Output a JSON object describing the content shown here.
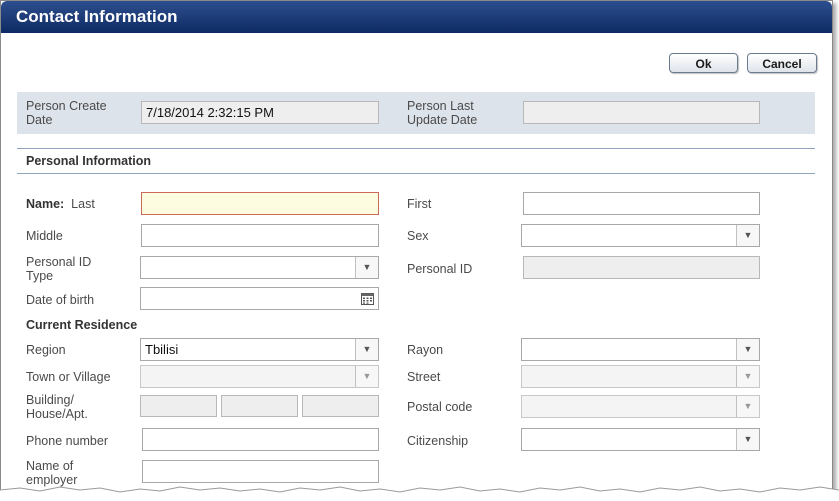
{
  "window": {
    "title": "Contact Information"
  },
  "toolbar": {
    "ok_label": "Ok",
    "cancel_label": "Cancel"
  },
  "info": {
    "create_label_1": "Person Create",
    "create_label_2": "Date",
    "create_value": "7/18/2014 2:32:15 PM",
    "update_label_1": "Person Last",
    "update_label_2": "Update Date",
    "update_value": ""
  },
  "personal": {
    "section_title": "Personal Information",
    "name_label": "Name:",
    "last_label": "Last",
    "last_value": "",
    "first_label": "First",
    "first_value": "",
    "middle_label": "Middle",
    "middle_value": "",
    "sex_label": "Sex",
    "sex_value": "",
    "pid_type_label_1": "Personal ID",
    "pid_type_label_2": "Type",
    "pid_type_value": "",
    "pid_label": "Personal ID",
    "pid_value": "",
    "dob_label": "Date of birth",
    "dob_value": ""
  },
  "residence": {
    "section_title": "Current Residence",
    "region_label": "Region",
    "region_value": "Tbilisi",
    "rayon_label": "Rayon",
    "rayon_value": "",
    "town_label": "Town or Village",
    "town_value": "",
    "street_label": "Street",
    "street_value": "",
    "building_label_1": "Building/",
    "building_label_2": "House/Apt.",
    "postal_label": "Postal code",
    "postal_value": "",
    "phone_label": "Phone number",
    "phone_value": "",
    "citizenship_label": "Citizenship",
    "citizenship_value": "",
    "employer_label_1": "Name of",
    "employer_label_2": "employer",
    "employer_value": ""
  },
  "icons": {
    "dropdown": "chevron-down-icon",
    "calendar": "calendar-icon"
  },
  "colors": {
    "title_bar": "#0d2a63",
    "info_bar": "#dde3ea",
    "required_field": "#fdfbe0"
  }
}
